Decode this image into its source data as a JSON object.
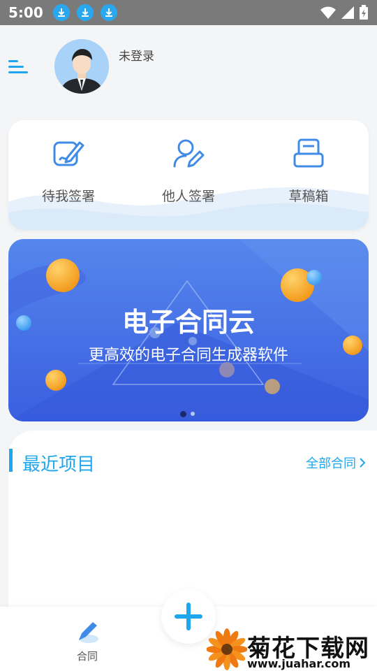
{
  "status_bar": {
    "time": "5:00",
    "download_icons": [
      "download-icon",
      "download-icon",
      "download-icon"
    ],
    "right_icons": [
      "wifi-icon",
      "signal-icon",
      "battery-charging-icon"
    ]
  },
  "header": {
    "menu_icon": "menu-icon",
    "avatar": "user-avatar",
    "login_status": "未登录"
  },
  "actions": [
    {
      "label": "待我签署",
      "icon": "sign-pen-icon"
    },
    {
      "label": "他人签署",
      "icon": "user-sign-icon"
    },
    {
      "label": "草稿箱",
      "icon": "draft-box-icon"
    }
  ],
  "banner": {
    "title": "电子合同云",
    "subtitle": "更高效的电子合同生成器软件",
    "page_count": 2,
    "active_page": 1
  },
  "recent": {
    "title": "最近项目",
    "all_link": "全部合同"
  },
  "bottom_nav": {
    "contract_label": "合同",
    "add_icon": "plus-icon"
  },
  "watermark": {
    "title": "菊花下载网",
    "url": "www.juahar.com"
  },
  "colors": {
    "accent": "#1ea7ee",
    "banner_top": "#5586ec",
    "banner_bottom": "#3a5fe0",
    "orb": "#f5a623"
  }
}
